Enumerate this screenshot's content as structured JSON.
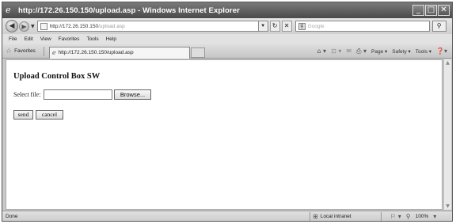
{
  "window": {
    "title": "http://172.26.150.150/upload.asp - Windows Internet Explorer",
    "minimize_glyph": "_",
    "maximize_glyph": "□",
    "close_glyph": "✕"
  },
  "address_bar": {
    "host": "http://172.26.150.150",
    "path": "/upload.asp",
    "search_placeholder": "Google"
  },
  "menu": {
    "items": [
      "File",
      "Edit",
      "View",
      "Favorites",
      "Tools",
      "Help"
    ]
  },
  "favorites_bar": {
    "favorites_label": "Favorites",
    "tab_title": "http://172.26.150.150/upload.asp"
  },
  "command_bar": {
    "page_label": "Page ▾",
    "safety_label": "Safety ▾",
    "tools_label": "Tools ▾"
  },
  "page": {
    "heading": "Upload Control Box SW",
    "file_label": "Select file:",
    "file_value": "",
    "browse_label": "Browse...",
    "send_label": "send",
    "cancel_label": "cancel"
  },
  "status_bar": {
    "status_text": "Done",
    "zone_label": "Local intranet",
    "zoom_label": "100%"
  }
}
